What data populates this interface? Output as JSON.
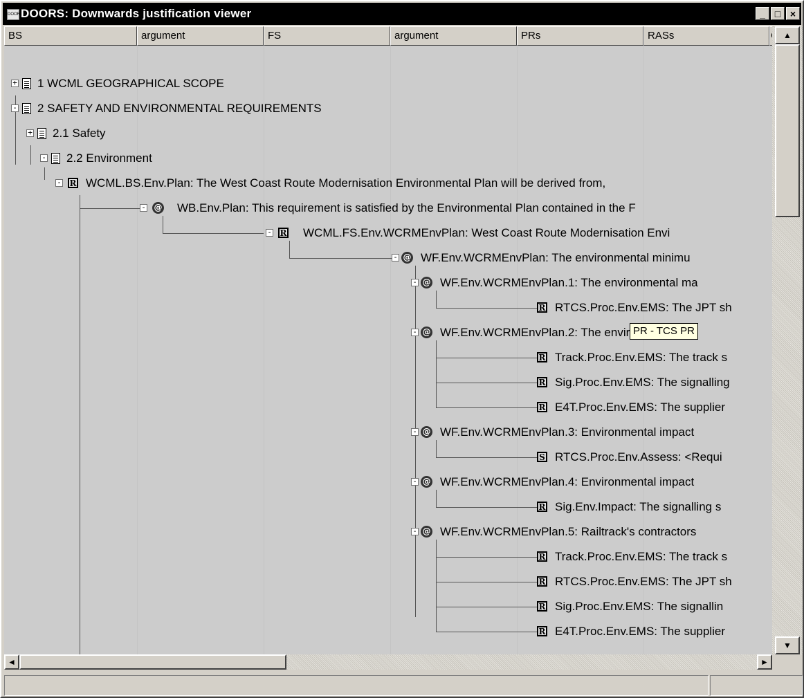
{
  "window": {
    "title": "DOORS: Downwards justification viewer",
    "app_icon": "DOORS",
    "minimize": "_",
    "maximize": "□",
    "close": "×"
  },
  "columns": [
    "BS",
    "argument",
    "FS",
    "argument",
    "PRs",
    "RASs",
    "C"
  ],
  "tree": {
    "n1": "1 WCML GEOGRAPHICAL SCOPE",
    "n2": "2 SAFETY AND ENVIRONMENTAL REQUIREMENTS",
    "n21": "2.1 Safety",
    "n22": "2.2 Environment",
    "bs": "WCML.BS.Env.Plan: The West Coast Route Modernisation Environmental Plan will be derived from,",
    "wb": "WB.Env.Plan: This requirement is satisfied by the Environmental Plan contained in the F",
    "fs": "WCML.FS.Env.WCRMEnvPlan: West Coast Route Modernisation Envi",
    "wf": "WF.Env.WCRMEnvPlan: The environmental minimu",
    "wf1": "WF.Env.WCRMEnvPlan.1: The environmental ma",
    "wf1a": "RTCS.Proc.Env.EMS: The JPT sh",
    "wf2": "WF.Env.WCRMEnvPlan.2: The environmental ma",
    "wf2a": "Track.Proc.Env.EMS: The track s",
    "wf2b": "Sig.Proc.Env.EMS: The signalling",
    "wf2c": "E4T.Proc.Env.EMS: The supplier",
    "wf3": "WF.Env.WCRMEnvPlan.3: Environmental impact",
    "wf3a": "RTCS.Proc.Env.Assess: <Requi",
    "wf4": "WF.Env.WCRMEnvPlan.4: Environmental impact",
    "wf4a": "Sig.Env.Impact: The signalling s",
    "wf5": "WF.Env.WCRMEnvPlan.5: Railtrack's contractors",
    "wf5a": "Track.Proc.Env.EMS: The track s",
    "wf5b": "RTCS.Proc.Env.EMS: The JPT sh",
    "wf5c": "Sig.Proc.Env.EMS: The signallin",
    "wf5d": "E4T.Proc.Env.EMS: The supplier"
  },
  "icons": {
    "requirement": "R",
    "stakeholder": "S",
    "argument": "@",
    "plus": "+",
    "minus": "-"
  },
  "tooltip": "PR - TCS PR",
  "scroll": {
    "up": "▲",
    "down": "▼",
    "left": "◄",
    "right": "►"
  }
}
